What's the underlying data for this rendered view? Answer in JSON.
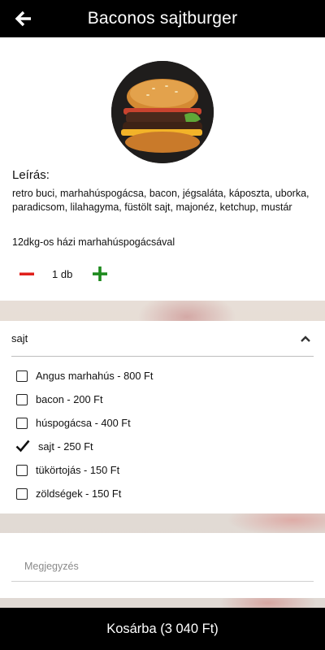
{
  "header": {
    "title": "Baconos sajtburger",
    "back_icon": "arrow-left-icon"
  },
  "product": {
    "image": "burger-photo",
    "description_heading": "Leírás:",
    "description": "retro buci, marhahúspogácsa, bacon, jégsaláta, káposzta, uborka, paradicsom, lilahagyma, füstölt sajt, majonéz, ketchup, mustár",
    "extra": "12dkg-os házi marhahúspogácsával",
    "quantity": "1 db"
  },
  "options_section": {
    "title": "sajt",
    "expanded": true,
    "items": [
      {
        "label": "Angus marhahús - 800 Ft",
        "checked": false
      },
      {
        "label": "bacon - 200 Ft",
        "checked": false
      },
      {
        "label": "húspogácsa - 400 Ft",
        "checked": false
      },
      {
        "label": "sajt - 250 Ft",
        "checked": true
      },
      {
        "label": "tükörtojás - 150 Ft",
        "checked": false
      },
      {
        "label": "zöldségek - 150 Ft",
        "checked": false
      }
    ]
  },
  "note": {
    "placeholder": "Megjegyzés",
    "value": ""
  },
  "cart": {
    "label": "Kosárba (3 040 Ft)"
  },
  "colors": {
    "header_bg": "#000000",
    "minus": "#e0201b",
    "plus": "#1e8a1e",
    "cart_bg": "#000000"
  }
}
